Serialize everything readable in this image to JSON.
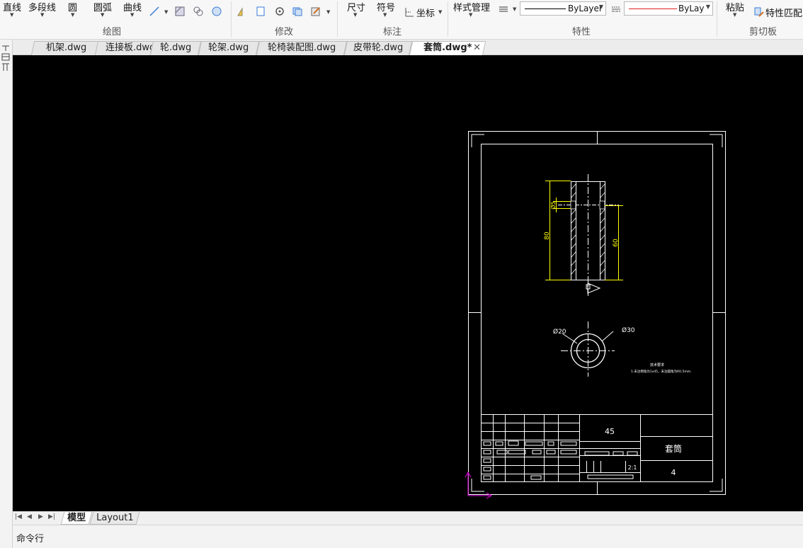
{
  "ribbon": {
    "draw": {
      "line": "直线",
      "polyline": "多段线",
      "circle": "圆",
      "arc": "圆弧",
      "curve": "曲线",
      "group_label": "绘图"
    },
    "modify": {
      "group_label": "修改"
    },
    "annotate": {
      "dimension": "尺寸",
      "symbol": "符号",
      "coordinate": "坐标",
      "group_label": "标注"
    },
    "properties": {
      "style_manager": "样式管理",
      "linetype": "ByLayer",
      "color": "ByLayer",
      "group_label": "特性",
      "linetype_color": "#000000",
      "color_swatch": "#e02020"
    },
    "clipboard": {
      "paste": "粘贴",
      "match_properties": "特性匹配",
      "group_label": "剪切板"
    }
  },
  "tabs": [
    {
      "label": "机架.dwg"
    },
    {
      "label": "连接板.dwg"
    },
    {
      "label": "轮.dwg"
    },
    {
      "label": "轮架.dwg"
    },
    {
      "label": "轮椅装配图.dwg"
    },
    {
      "label": "皮带轮.dwg"
    },
    {
      "label": "套筒.dwg*",
      "active": true
    }
  ],
  "drawing": {
    "dim_phi5": "Ø5",
    "dim_80": "80",
    "dim_60": "60",
    "dim_phi20": "Ø20",
    "dim_phi30": "Ø30",
    "tech_title": "技术要求",
    "tech_note": "1.未注倒角为1x45，未注圆角为R0.5mm.",
    "material": "45",
    "part_name": "套筒",
    "scale": "2:1",
    "sheet_no": "4",
    "line_color": "#ffffff",
    "dim_color": "#ffff00",
    "ucs_color": "#c000c0"
  },
  "layout_tabs": {
    "model": "模型",
    "layout1": "Layout1"
  },
  "command_line": {
    "label": "命令行"
  }
}
